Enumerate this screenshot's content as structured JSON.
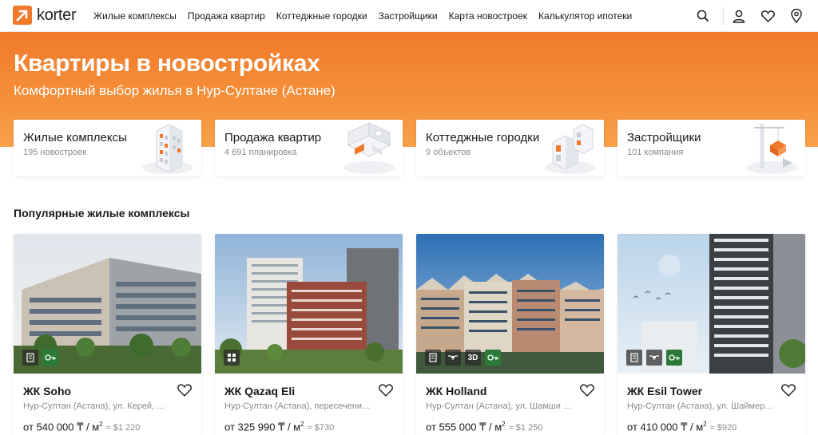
{
  "app": {
    "logo_text": "korter",
    "brand_color": "#f07a2b"
  },
  "nav": [
    {
      "label": "Жилые комплексы"
    },
    {
      "label": "Продажа квартир"
    },
    {
      "label": "Коттеджные городки"
    },
    {
      "label": "Застройщики"
    },
    {
      "label": "Карта новостроек"
    },
    {
      "label": "Калькулятор ипотеки"
    }
  ],
  "header_icons": [
    "search-icon",
    "user-icon",
    "heart-icon",
    "map-pin-icon"
  ],
  "hero": {
    "title": "Квартиры в новостройках",
    "subtitle": "Комфортный выбор жилья в Нур-Султане (Астане)"
  },
  "categories": [
    {
      "title": "Жилые комплексы",
      "count": "195 новостроек",
      "icon": "building-icon"
    },
    {
      "title": "Продажа квартир",
      "count": "4 691 планировка",
      "icon": "apartment-plan-icon"
    },
    {
      "title": "Коттеджные городки",
      "count": "9 объектов",
      "icon": "cottage-icon"
    },
    {
      "title": "Застройщики",
      "count": "101 компания",
      "icon": "crane-icon"
    }
  ],
  "popular": {
    "title": "Популярные жилые комплексы",
    "items": [
      {
        "name": "ЖК Soho",
        "address": "Нур-Султан (Астана), ул. Керей, ...",
        "price": "от 540 000 ₸ / м",
        "usd": "≈ $1 220",
        "badges": [
          "docs-icon",
          "key-icon"
        ]
      },
      {
        "name": "ЖК Qazaq Eli",
        "address": "Нур-Султан (Астана), пересечение ...",
        "price": "от 325 990 ₸ / м",
        "usd": "≈ $730",
        "badges": [
          "layout-icon"
        ]
      },
      {
        "name": "ЖК Holland",
        "address": "Нур-Султан (Астана), ул. Шамши ...",
        "price": "от 555 000 ₸ / м",
        "usd": "≈ $1 250",
        "badges": [
          "docs-icon",
          "drone-icon",
          "3D",
          "key-icon"
        ]
      },
      {
        "name": "ЖК Esil Tower",
        "address": "Нур-Султан (Астана), ул. Шаймерден ...",
        "price": "от 410 000 ₸ / м",
        "usd": "≈ $920",
        "badges": [
          "docs-icon",
          "drone-icon",
          "key-icon"
        ]
      }
    ]
  }
}
